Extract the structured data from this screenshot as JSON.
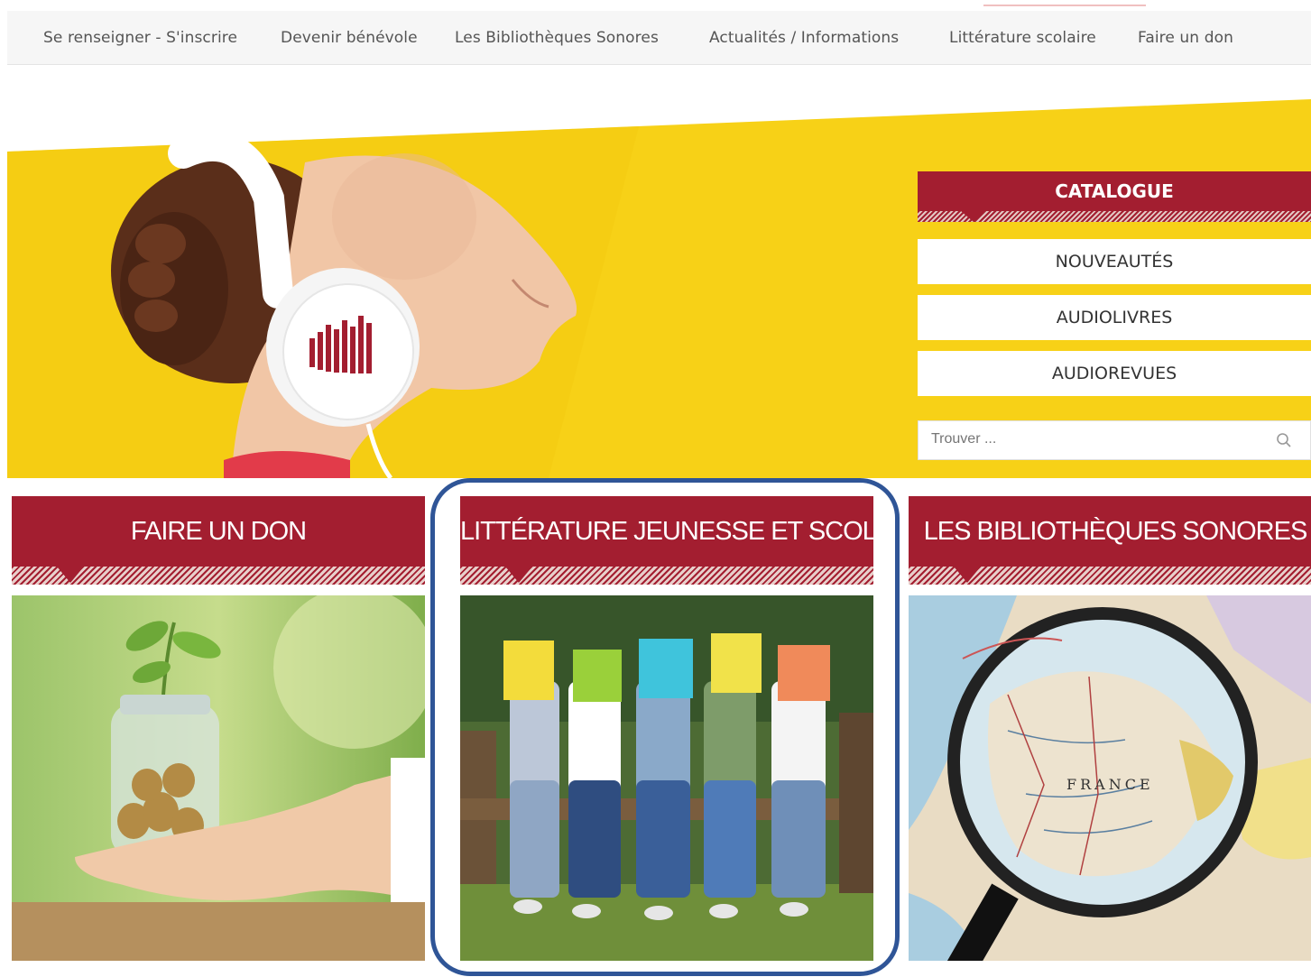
{
  "nav": {
    "items": [
      "Se renseigner - S'inscrire",
      "Devenir bénévole",
      "Les Bibliothèques Sonores",
      "Actualités / Informations",
      "Littérature scolaire",
      "Faire un don"
    ]
  },
  "catalogue": {
    "title": "CATALOGUE",
    "buttons": [
      "NOUVEAUTÉS",
      "AUDIOLIVRES",
      "AUDIOREVUES"
    ],
    "search_placeholder": "Trouver ..."
  },
  "cards": [
    {
      "title": "FAIRE UN DON"
    },
    {
      "title": "LITTÉRATURE JEUNESSE ET SCOLAIRE"
    },
    {
      "title": "LES BIBLIOTHÈQUES SONORES"
    }
  ],
  "map": {
    "country_label": "FRANCE"
  },
  "colors": {
    "brand_red": "#a31e30",
    "hero_yellow": "#f7d117",
    "highlight_blue": "#2f5597"
  }
}
